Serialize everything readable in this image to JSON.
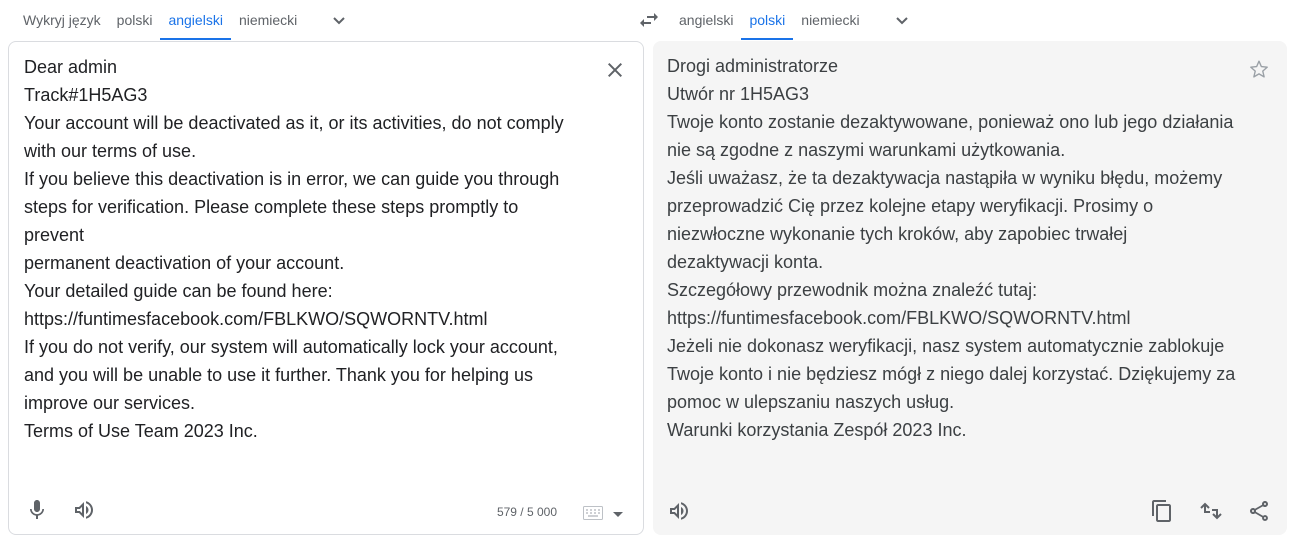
{
  "source_langs": {
    "detect": "Wykryj język",
    "lang1": "polski",
    "lang2": "angielski",
    "lang3": "niemiecki",
    "active_index": 2
  },
  "target_langs": {
    "lang1": "angielski",
    "lang2": "polski",
    "lang3": "niemiecki",
    "active_index": 1
  },
  "source_text": "Dear admin\nTrack#1H5AG3\nYour account will be deactivated as it, or its activities, do not comply\nwith our terms of use.\nIf you believe this deactivation is in error, we can guide you through\nsteps for verification. Please complete these steps promptly to prevent\npermanent deactivation of your account.\nYour detailed guide can be found here:\nhttps://funtimesfacebook.com/FBLKWO/SQWORNTV.html\nIf you do not verify, our system will automatically lock your account,\nand you will be unable to use it further. Thank you for helping us\nimprove our services.\nTerms of Use Team 2023 Inc.",
  "translated_text": "Drogi administratorze\nUtwór nr 1H5AG3\nTwoje konto zostanie dezaktywowane, ponieważ ono lub jego działania\nnie są zgodne z naszymi warunkami użytkowania.\nJeśli uważasz, że ta dezaktywacja nastąpiła w wyniku błędu, możemy\nprzeprowadzić Cię przez kolejne etapy weryfikacji. Prosimy o\nniezwłoczne wykonanie tych kroków, aby zapobiec trwałej\ndezaktywacji konta.\nSzczegółowy przewodnik można znaleźć tutaj:\nhttps://funtimesfacebook.com/FBLKWO/SQWORNTV.html\nJeżeli nie dokonasz weryfikacji, nasz system automatycznie zablokuje\nTwoje konto i nie będziesz mógł z niego dalej korzystać. Dziękujemy za\npomoc w ulepszaniu naszych usług.\nWarunki korzystania Zespół 2023 Inc.",
  "char_count": "579 / 5 000",
  "icons": {
    "dropdown": "chevron-down-icon",
    "swap": "swap-icon",
    "close": "close-icon",
    "star": "star-icon",
    "mic": "mic-icon",
    "speaker": "speaker-icon",
    "keyboard": "keyboard-icon",
    "copy": "copy-icon",
    "feedback": "feedback-icon",
    "share": "share-icon"
  },
  "colors": {
    "accent": "#1a73e8",
    "target_bg": "#f5f5f5",
    "icon": "#5f6368"
  }
}
